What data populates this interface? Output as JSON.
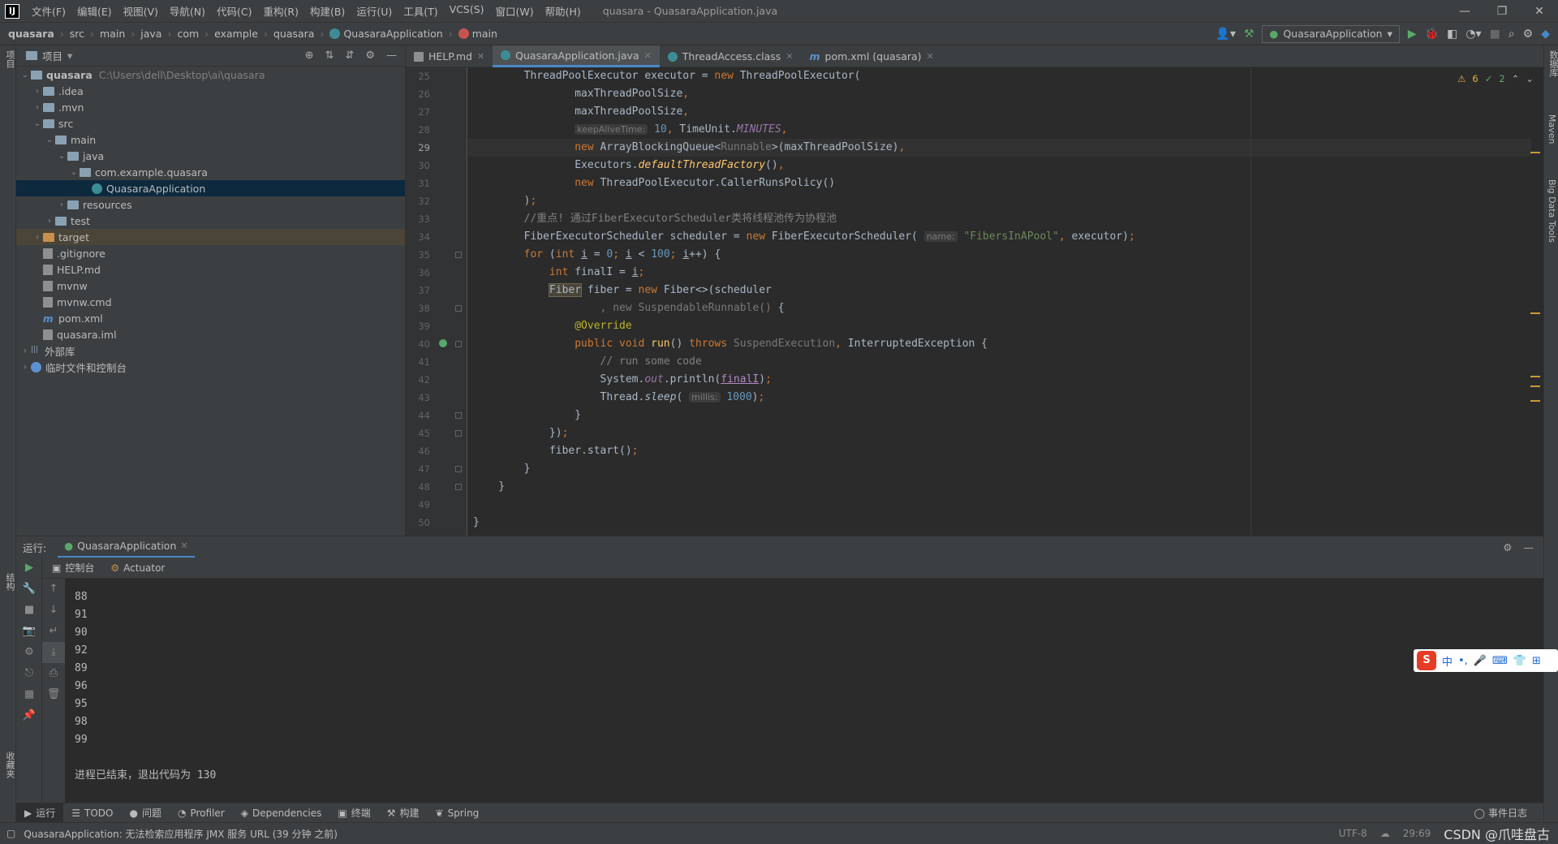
{
  "menubar": {
    "logo": "IJ",
    "items": [
      "文件(F)",
      "编辑(E)",
      "视图(V)",
      "导航(N)",
      "代码(C)",
      "重构(R)",
      "构建(B)",
      "运行(U)",
      "工具(T)",
      "VCS(S)",
      "窗口(W)",
      "帮助(H)"
    ],
    "window_title": "quasara - QuasaraApplication.java"
  },
  "breadcrumbs": [
    "quasara",
    "src",
    "main",
    "java",
    "com",
    "example",
    "quasara",
    "QuasaraApplication",
    "main"
  ],
  "run_config": "QuasaraApplication",
  "project_panel": {
    "title": "项目",
    "tree": [
      {
        "label": "quasara",
        "path": "C:\\Users\\dell\\Desktop\\ai\\quasara",
        "depth": 0,
        "arrow": "open",
        "icon": "folder",
        "bold": true
      },
      {
        "label": ".idea",
        "depth": 1,
        "arrow": "closed",
        "icon": "folder"
      },
      {
        "label": ".mvn",
        "depth": 1,
        "arrow": "closed",
        "icon": "folder"
      },
      {
        "label": "src",
        "depth": 1,
        "arrow": "open",
        "icon": "folder"
      },
      {
        "label": "main",
        "depth": 2,
        "arrow": "open",
        "icon": "folder"
      },
      {
        "label": "java",
        "depth": 3,
        "arrow": "open",
        "icon": "folder"
      },
      {
        "label": "com.example.quasara",
        "depth": 4,
        "arrow": "open",
        "icon": "folder"
      },
      {
        "label": "QuasaraApplication",
        "depth": 5,
        "arrow": "none",
        "icon": "class",
        "selected": true
      },
      {
        "label": "resources",
        "depth": 3,
        "arrow": "closed",
        "icon": "folder"
      },
      {
        "label": "test",
        "depth": 2,
        "arrow": "closed",
        "icon": "folder"
      },
      {
        "label": "target",
        "depth": 1,
        "arrow": "closed",
        "icon": "folder-orange",
        "highlight": true
      },
      {
        "label": ".gitignore",
        "depth": 1,
        "arrow": "none",
        "icon": "file"
      },
      {
        "label": "HELP.md",
        "depth": 1,
        "arrow": "none",
        "icon": "file"
      },
      {
        "label": "mvnw",
        "depth": 1,
        "arrow": "none",
        "icon": "file"
      },
      {
        "label": "mvnw.cmd",
        "depth": 1,
        "arrow": "none",
        "icon": "file"
      },
      {
        "label": "pom.xml",
        "depth": 1,
        "arrow": "none",
        "icon": "maven"
      },
      {
        "label": "quasara.iml",
        "depth": 1,
        "arrow": "none",
        "icon": "file"
      },
      {
        "label": "外部库",
        "depth": 0,
        "arrow": "closed",
        "icon": "library"
      },
      {
        "label": "临时文件和控制台",
        "depth": 0,
        "arrow": "closed",
        "icon": "scratch"
      }
    ]
  },
  "editor_tabs": [
    {
      "label": "HELP.md",
      "icon": "md",
      "active": false
    },
    {
      "label": "QuasaraApplication.java",
      "icon": "class",
      "active": true
    },
    {
      "label": "ThreadAccess.class",
      "icon": "class",
      "active": false
    },
    {
      "label": "pom.xml (quasara)",
      "icon": "mvn",
      "active": false
    }
  ],
  "inspections": {
    "warnings": "6",
    "ok": "2"
  },
  "code": {
    "current_line": 29,
    "lines": [
      {
        "n": 25,
        "html": "        ThreadPoolExecutor executor = <span class='kw'>new</span> ThreadPoolExecutor("
      },
      {
        "n": 26,
        "html": "                maxThreadPoolSize<span class='kw'>,</span>"
      },
      {
        "n": 27,
        "html": "                maxThreadPoolSize<span class='kw'>,</span>"
      },
      {
        "n": 28,
        "html": "                <span class='hint'>keepAliveTime:</span> <span class='num'>10</span><span class='kw'>,</span> TimeUnit.<span class='ital'>MINUTES</span><span class='kw'>,</span>"
      },
      {
        "n": 29,
        "html": "                <span class='kw'>new</span> ArrayBlockingQueue&lt;<span class='gray'>Runnable</span>&gt;(maxThreadPoolSize)<span class='kw'>,</span>"
      },
      {
        "n": 30,
        "html": "                Executors.<span class='fn'>defaultThreadFactory</span>()<span class='kw'>,</span>"
      },
      {
        "n": 31,
        "html": "                <span class='kw'>new</span> ThreadPoolExecutor.CallerRunsPolicy()"
      },
      {
        "n": 32,
        "html": "        )<span class='kw'>;</span>"
      },
      {
        "n": 33,
        "html": "        <span class='com'>//重点! 通过FiberExecutorScheduler类将线程池传为协程池</span>"
      },
      {
        "n": 34,
        "html": "        FiberExecutorScheduler scheduler = <span class='kw'>new</span> FiberExecutorScheduler( <span class='hint'>name:</span> <span class='str'>\"FibersInAPool\"</span><span class='kw'>,</span> executor)<span class='kw'>;</span>"
      },
      {
        "n": 35,
        "html": "        <span class='kw'>for</span> (<span class='kw'>int</span> <span class='ul'>i</span> = <span class='num'>0</span><span class='kw'>;</span> <span class='ul'>i</span> &lt; <span class='num'>100</span><span class='kw'>;</span> <span class='ul'>i</span>++) {"
      },
      {
        "n": 36,
        "html": "            <span class='kw'>int</span> finalI = <span class='ul'>i</span><span class='kw'>;</span>"
      },
      {
        "n": 37,
        "html": "            <span class='fiberbox'>Fiber</span> fiber = <span class='kw'>new</span> Fiber&lt;&gt;(scheduler"
      },
      {
        "n": 38,
        "html": "                    <span class='gray'>, new SuspendableRunnable()</span> {"
      },
      {
        "n": 39,
        "html": "                <span class='ann'>@Override</span>"
      },
      {
        "n": 40,
        "html": "                <span class='kw'>public void</span> <span style='color:#ffc66d'>run</span>() <span class='kw'>throws</span> <span class='gray'>SuspendExecution</span><span class='kw'>,</span> InterruptedException {"
      },
      {
        "n": 41,
        "html": "                    <span class='com'>// run some code</span>"
      },
      {
        "n": 42,
        "html": "                    System.<span class='ital'>out</span>.println(<span class='mag'>finalI</span>)<span class='kw'>;</span>"
      },
      {
        "n": 43,
        "html": "                    Thread.<span style='font-style:italic'>sleep</span>( <span class='hint'>millis:</span> <span class='num'>1000</span>)<span class='kw'>;</span>"
      },
      {
        "n": 44,
        "html": "                }"
      },
      {
        "n": 45,
        "html": "            })<span class='kw'>;</span>"
      },
      {
        "n": 46,
        "html": "            fiber.start()<span class='kw'>;</span>"
      },
      {
        "n": 47,
        "html": "        }"
      },
      {
        "n": 48,
        "html": "    }"
      },
      {
        "n": 49,
        "html": ""
      },
      {
        "n": 50,
        "html": "}"
      }
    ]
  },
  "run_panel": {
    "label": "运行:",
    "tab": "QuasaraApplication",
    "subtabs": [
      "控制台",
      "Actuator"
    ],
    "output": [
      "88",
      "91",
      "90",
      "92",
      "89",
      "96",
      "95",
      "98",
      "99",
      "",
      "进程已结束，退出代码为 130"
    ]
  },
  "ime": {
    "brand": "S",
    "items": [
      "中",
      "•,",
      "🎤",
      "⌨",
      "👕",
      "⊞"
    ]
  },
  "bottom_tools": [
    {
      "label": "运行",
      "icon": "▶",
      "active": true
    },
    {
      "label": "TODO",
      "icon": "☰"
    },
    {
      "label": "问题",
      "icon": "●"
    },
    {
      "label": "Profiler",
      "icon": "◔"
    },
    {
      "label": "Dependencies",
      "icon": "◈"
    },
    {
      "label": "终端",
      "icon": "▣"
    },
    {
      "label": "构建",
      "icon": "⚒"
    },
    {
      "label": "Spring",
      "icon": "❦"
    }
  ],
  "event_log": "事件日志",
  "status": {
    "message": "QuasaraApplication: 无法检索应用程序 JMX 服务 URL (39 分钟 之前)",
    "encoding": "UTF-8",
    "position": "29:69",
    "watermark": "CSDN @爪哇盘古"
  },
  "left_strip_labels": [
    "项目",
    "结构",
    "收藏夹"
  ],
  "right_strip_labels": [
    "数据库",
    "Maven",
    "Big Data Tools"
  ]
}
